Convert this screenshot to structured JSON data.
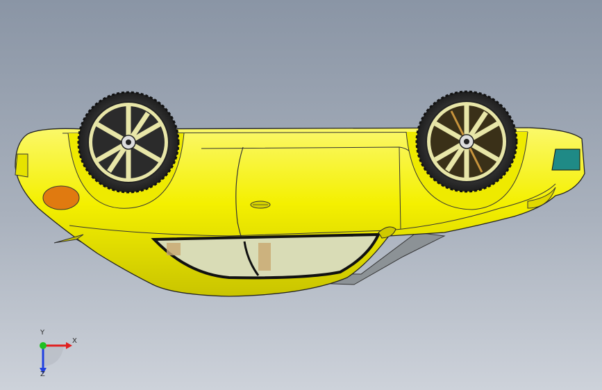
{
  "viewport": {
    "background_top": "#8a95a5",
    "background_bottom": "#cdd2da"
  },
  "model": {
    "body_color": "#f4f000",
    "tire_color": "#2e2e2e",
    "wheel_rim_color": "#e8e6a8",
    "glass_color": "#d9dcb6",
    "light_color": "#e07a10",
    "accent_color": "#1f8a86"
  },
  "triad": {
    "x_label": "X",
    "y_label": "Y",
    "z_label": "Z",
    "x_color": "#e02020",
    "y_color": "#20c020",
    "z_color": "#2040e0"
  }
}
